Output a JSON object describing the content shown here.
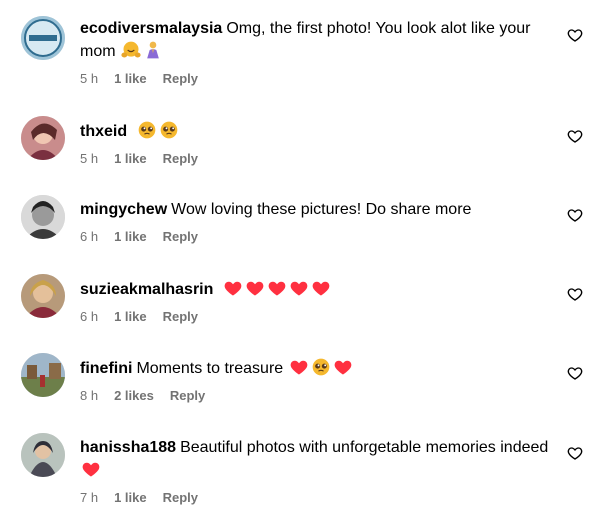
{
  "comments": [
    {
      "username": "ecodiversmalaysia",
      "text": "Omg, the first photo! You look alot like your mom",
      "emojis": [
        "hug",
        "pray"
      ],
      "time": "5 h",
      "likes": "1 like",
      "reply": "Reply"
    },
    {
      "username": "thxeid",
      "text": "",
      "emojis": [
        "pleading",
        "pleading"
      ],
      "time": "5 h",
      "likes": "1 like",
      "reply": "Reply"
    },
    {
      "username": "mingychew",
      "text": "Wow loving these pictures! Do share more",
      "emojis": [],
      "time": "6 h",
      "likes": "1 like",
      "reply": "Reply"
    },
    {
      "username": "suzieakmalhasrin",
      "text": "",
      "emojis": [
        "heart",
        "heart",
        "heart",
        "heart",
        "heart"
      ],
      "time": "6 h",
      "likes": "1 like",
      "reply": "Reply"
    },
    {
      "username": "finefini",
      "text": "Moments to treasure",
      "emojis": [
        "heart",
        "pleading",
        "heart"
      ],
      "time": "8 h",
      "likes": "2 likes",
      "reply": "Reply"
    },
    {
      "username": "hanissha188",
      "text": "Beautiful photos with unforgetable memories indeed",
      "emojis": [
        "heart"
      ],
      "time": "7 h",
      "likes": "1 like",
      "reply": "Reply"
    }
  ],
  "colors": {
    "meta": "#737373",
    "heart": "#ff3040",
    "emoji_face": "#f5b82e"
  }
}
